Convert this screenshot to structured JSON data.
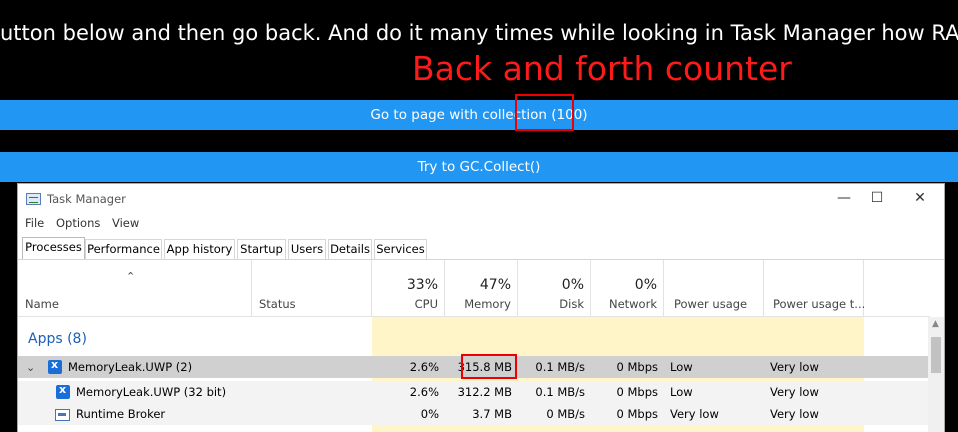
{
  "app": {
    "instruction": "utton below and then go back. And do it many times while looking in Task Manager how RA",
    "annotation": "Back and forth counter",
    "goto_button": "Go to page with collection (100)",
    "gc_button": "Try to GC.Collect()"
  },
  "task_manager": {
    "title": "Task Manager",
    "menu": [
      "File",
      "Options",
      "View"
    ],
    "tabs": [
      "Processes",
      "Performance",
      "App history",
      "Startup",
      "Users",
      "Details",
      "Services"
    ],
    "active_tab": "Processes",
    "columns": {
      "name": "Name",
      "status": "Status",
      "cpu_pct": "33%",
      "cpu": "CPU",
      "memory_pct": "47%",
      "memory": "Memory",
      "disk_pct": "0%",
      "disk": "Disk",
      "network_pct": "0%",
      "network": "Network",
      "power": "Power usage",
      "power_trend": "Power usage t..."
    },
    "group_label": "Apps (8)",
    "rows": [
      {
        "name": "MemoryLeak.UWP (2)",
        "cpu": "2.6%",
        "memory": "315.8 MB",
        "disk": "0.1 MB/s",
        "network": "0 Mbps",
        "power": "Low",
        "power_trend": "Very low"
      },
      {
        "name": "MemoryLeak.UWP (32 bit)",
        "cpu": "2.6%",
        "memory": "312.2 MB",
        "disk": "0.1 MB/s",
        "network": "0 Mbps",
        "power": "Low",
        "power_trend": "Very low"
      },
      {
        "name": "Runtime Broker",
        "cpu": "0%",
        "memory": "3.7 MB",
        "disk": "0 MB/s",
        "network": "0 Mbps",
        "power": "Very low",
        "power_trend": "Very low"
      }
    ]
  },
  "colors": {
    "button": "#2196f3",
    "annotation": "#ff1a1a",
    "highlight_box": "#e00000"
  }
}
